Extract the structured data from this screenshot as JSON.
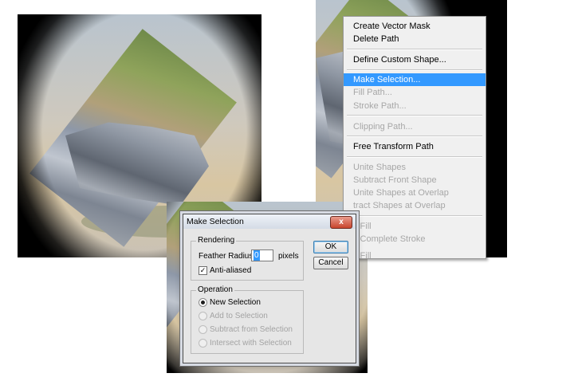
{
  "context_menu": {
    "items": [
      {
        "label": "Create Vector Mask",
        "state": "enabled"
      },
      {
        "label": "Delete Path",
        "state": "enabled"
      },
      {
        "label": "Define Custom Shape...",
        "state": "enabled"
      },
      {
        "label": "Make Selection...",
        "state": "highlighted"
      },
      {
        "label": "Fill Path...",
        "state": "disabled"
      },
      {
        "label": "Stroke Path...",
        "state": "disabled"
      },
      {
        "label": "Clipping Path...",
        "state": "disabled"
      },
      {
        "label": "Free Transform Path",
        "state": "enabled"
      },
      {
        "label": "Unite Shapes",
        "state": "disabled"
      },
      {
        "label": "Subtract Front Shape",
        "state": "disabled"
      },
      {
        "label": "Unite Shapes at Overlap",
        "state": "disabled"
      },
      {
        "label": "tract Shapes at Overlap",
        "state": "disabled"
      },
      {
        "label": "y Fill",
        "state": "disabled"
      },
      {
        "label": "y Complete Stroke",
        "state": "disabled"
      },
      {
        "label": "y Fill",
        "state": "disabled"
      }
    ],
    "highlight_color": "#3399ff"
  },
  "dialog": {
    "title": "Make Selection",
    "close_label": "x",
    "rendering": {
      "group_label": "Rendering",
      "feather_label": "Feather Radius:",
      "feather_value": "0",
      "feather_unit": "pixels",
      "antialiased_label": "Anti-aliased",
      "antialiased_checked": true
    },
    "operation": {
      "group_label": "Operation",
      "options": [
        {
          "label": "New Selection",
          "selected": true,
          "enabled": true
        },
        {
          "label": "Add to Selection",
          "selected": false,
          "enabled": false
        },
        {
          "label": "Subtract from Selection",
          "selected": false,
          "enabled": false
        },
        {
          "label": "Intersect with Selection",
          "selected": false,
          "enabled": false
        }
      ]
    },
    "ok_label": "OK",
    "cancel_label": "Cancel"
  },
  "colors": {
    "dialog_bg": "#e6e6e6",
    "close_button": "#c8442d"
  }
}
